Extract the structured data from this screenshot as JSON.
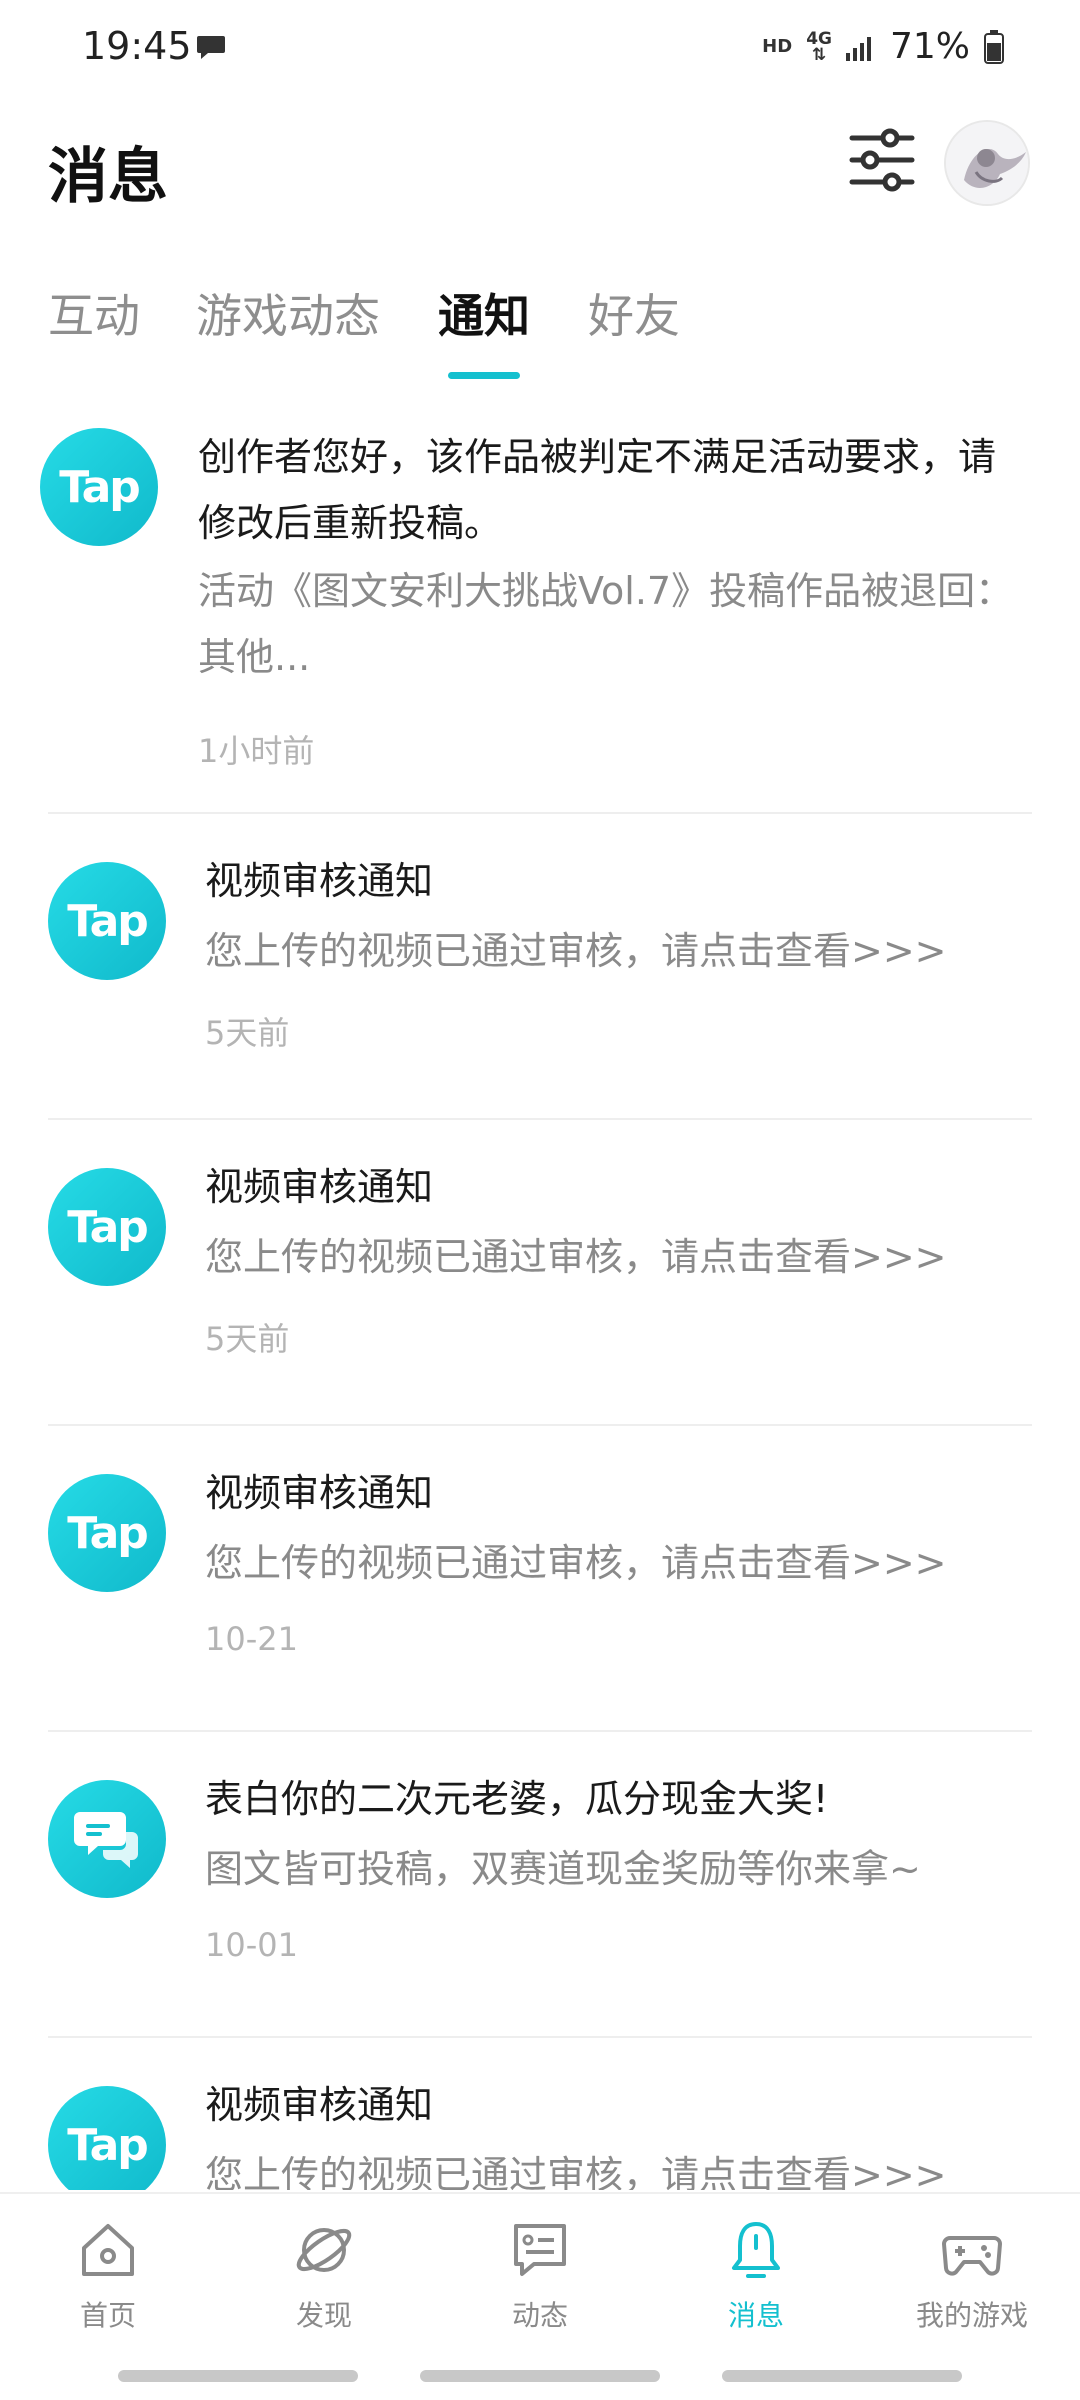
{
  "status_bar": {
    "time": "19:45",
    "hd": "HD",
    "network": "4G",
    "battery": "71%"
  },
  "header": {
    "title": "消息",
    "filter_icon": "sliders-icon",
    "avatar_icon": "user-avatar"
  },
  "tabs": [
    {
      "label": "互动",
      "active": false
    },
    {
      "label": "游戏动态",
      "active": false
    },
    {
      "label": "通知",
      "active": true
    },
    {
      "label": "好友",
      "active": false
    }
  ],
  "notifications": [
    {
      "icon": "tap-logo",
      "title": "创作者您好，该作品被判定不满足活动要求，请修改后重新投稿。",
      "body": "活动《图文安利大挑战Vol.7》投稿作品被退回：其他...",
      "time": "1小时前"
    },
    {
      "icon": "tap-logo",
      "title": "视频审核通知",
      "body": "您上传的视频已通过审核，请点击查看>>>",
      "time": "5天前"
    },
    {
      "icon": "tap-logo",
      "title": "视频审核通知",
      "body": "您上传的视频已通过审核，请点击查看>>>",
      "time": "5天前"
    },
    {
      "icon": "tap-logo",
      "title": "视频审核通知",
      "body": "您上传的视频已通过审核，请点击查看>>>",
      "time": "10-21"
    },
    {
      "icon": "chat-bubble-icon",
      "title": "表白你的二次元老婆，瓜分现金大奖!",
      "body": "图文皆可投稿，双赛道现金奖励等你来拿~",
      "time": "10-01"
    },
    {
      "icon": "tap-logo",
      "title": "视频审核通知",
      "body": "您上传的视频已通过审核，请点击查看>>>",
      "time": ""
    }
  ],
  "tap_logo_text": "Tap",
  "bottom_nav": [
    {
      "label": "首页",
      "icon": "home-icon",
      "active": false
    },
    {
      "label": "发现",
      "icon": "planet-icon",
      "active": false
    },
    {
      "label": "动态",
      "icon": "feed-icon",
      "active": false
    },
    {
      "label": "消息",
      "icon": "bell-icon",
      "active": true
    },
    {
      "label": "我的游戏",
      "icon": "gamepad-icon",
      "active": false
    }
  ],
  "colors": {
    "accent": "#14c0cf",
    "text_primary": "#1a1a1a",
    "text_secondary": "#8a8a8a",
    "text_muted": "#b4b4b4"
  }
}
